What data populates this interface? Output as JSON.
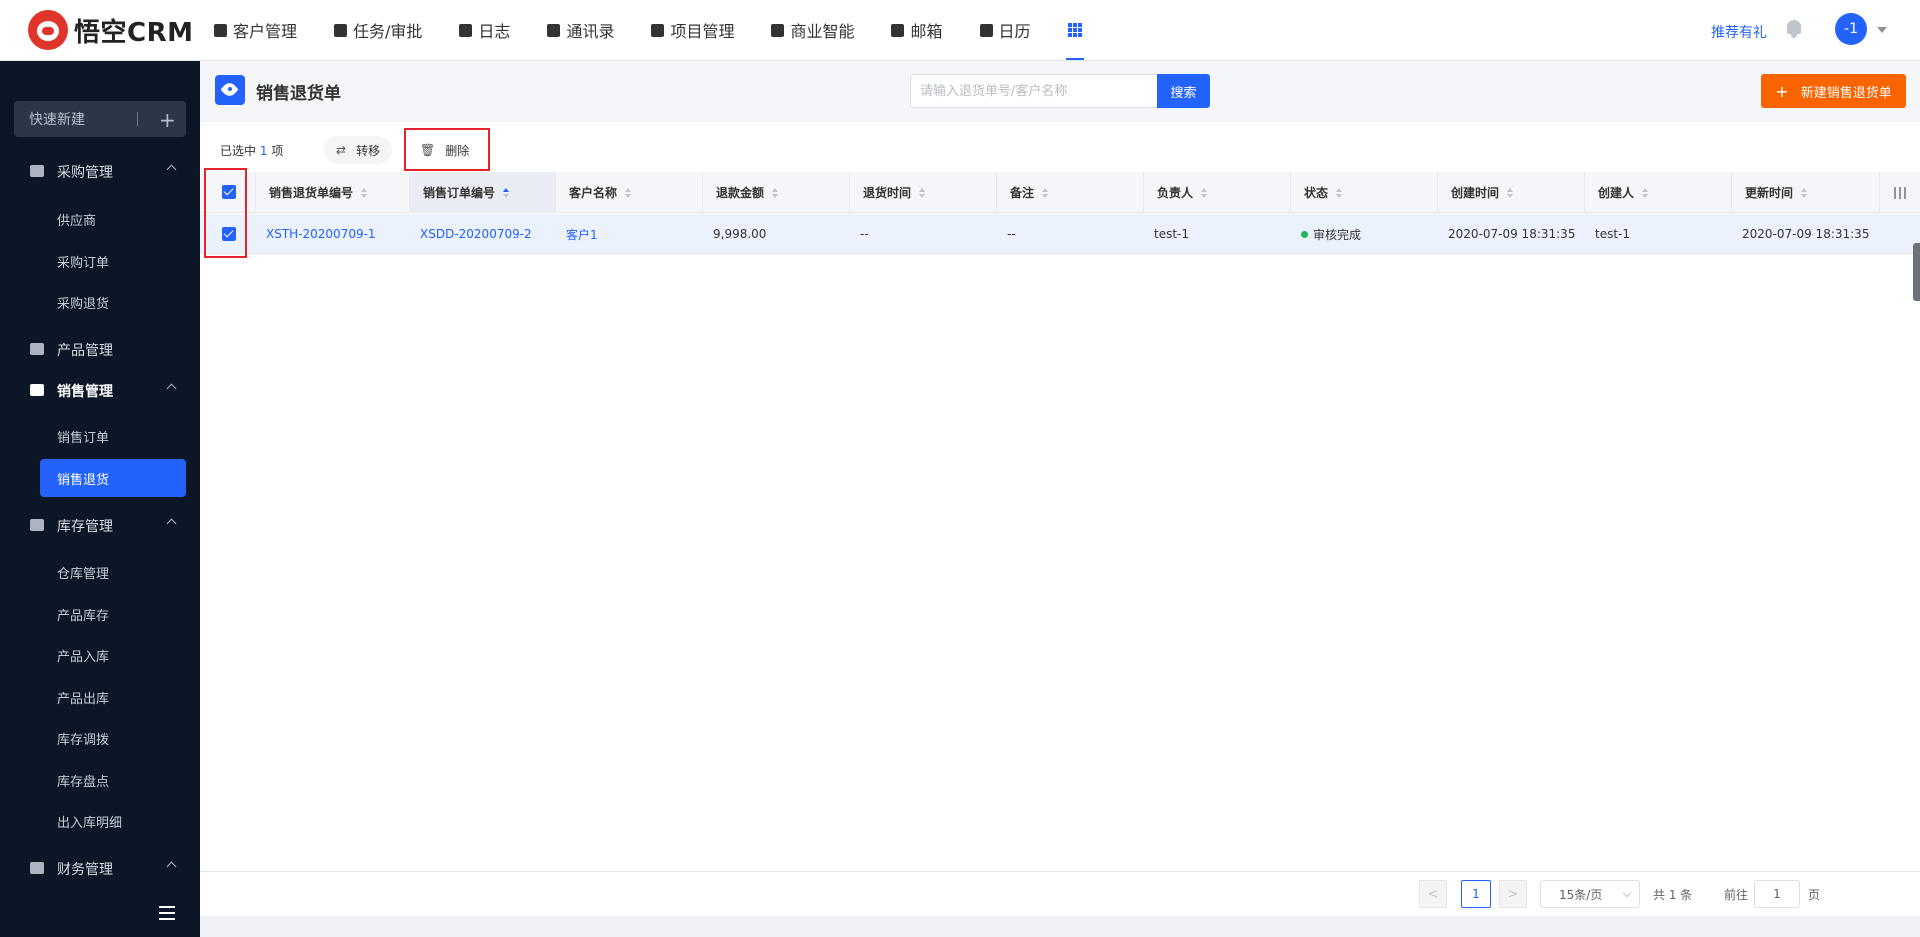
{
  "brand": {
    "logo_text": "悟空CRM"
  },
  "nav": {
    "items": [
      {
        "label": "客户管理",
        "icon": "building-icon"
      },
      {
        "label": "任务/审批",
        "icon": "briefcase-icon"
      },
      {
        "label": "日志",
        "icon": "log-icon"
      },
      {
        "label": "通讯录",
        "icon": "contacts-icon"
      },
      {
        "label": "项目管理",
        "icon": "project-icon"
      },
      {
        "label": "商业智能",
        "icon": "bi-icon"
      },
      {
        "label": "邮箱",
        "icon": "mail-icon"
      },
      {
        "label": "日历",
        "icon": "calendar-icon"
      }
    ],
    "apps_icon": "apps-grid-icon",
    "recommend": "推荐有礼",
    "avatar_text": "-1"
  },
  "sidebar": {
    "quick_create": "快速新建",
    "groups": [
      {
        "label": "采购管理",
        "icon": "cart-icon",
        "items": [
          "供应商",
          "采购订单",
          "采购退货"
        ]
      },
      {
        "label": "产品管理",
        "icon": "box-icon",
        "items": []
      },
      {
        "label": "销售管理",
        "icon": "tag-icon",
        "items": [
          "销售订单",
          "销售退货"
        ]
      },
      {
        "label": "库存管理",
        "icon": "archive-icon",
        "items": [
          "仓库管理",
          "产品库存",
          "产品入库",
          "产品出库",
          "库存调拨",
          "库存盘点",
          "出入库明细"
        ]
      },
      {
        "label": "财务管理",
        "icon": "finance-icon",
        "items": []
      }
    ],
    "active_item": "销售退货"
  },
  "page": {
    "title": "销售退货单",
    "search_placeholder": "请输入退货单号/客户名称",
    "search_value": "",
    "search_button": "搜索",
    "new_button": "新建销售退货单"
  },
  "toolbar": {
    "selected_prefix": "已选中",
    "selected_count": "1",
    "selected_suffix": "项",
    "transfer": "转移",
    "delete": "删除"
  },
  "table": {
    "columns": [
      "销售退货单编号",
      "销售订单编号",
      "客户名称",
      "退款金额",
      "退货时间",
      "备注",
      "负责人",
      "状态",
      "创建时间",
      "创建人",
      "更新时间"
    ],
    "rows": [
      {
        "return_no": "XSTH-20200709-1",
        "order_no": "XSDD-20200709-2",
        "customer": "客户1",
        "amount": "9,998.00",
        "return_time": "--",
        "remark": "--",
        "owner": "test-1",
        "status": "审核完成",
        "created_at": "2020-07-09 18:31:35",
        "creator": "test-1",
        "updated_at": "2020-07-09 18:31:35"
      }
    ]
  },
  "pager": {
    "prev": "<",
    "current": "1",
    "next": ">",
    "page_size": "15条/页",
    "total": "共 1 条",
    "goto_label": "前往",
    "goto_value": "1",
    "page_label": "页"
  },
  "colors": {
    "primary": "#2362fb",
    "orange": "#fa6400",
    "sidebar": "#0c1627",
    "status_done": "#20b559"
  }
}
